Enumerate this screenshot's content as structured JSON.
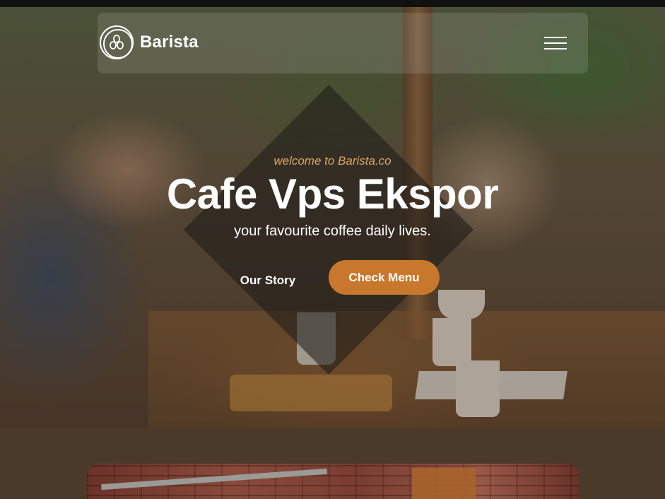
{
  "brand": {
    "name": "Barista"
  },
  "nav": {
    "menu_icon": "hamburger-menu-icon"
  },
  "hero": {
    "eyebrow": "welcome to Barista.co",
    "title": "Cafe Vps Ekspor",
    "subtitle": "your favourite coffee daily lives.",
    "buttons": {
      "story_label": "Our Story",
      "menu_label": "Check Menu"
    }
  },
  "colors": {
    "accent": "#c8782c",
    "eyebrow": "#d9a46a",
    "lower_bg": "#4a3a29"
  }
}
